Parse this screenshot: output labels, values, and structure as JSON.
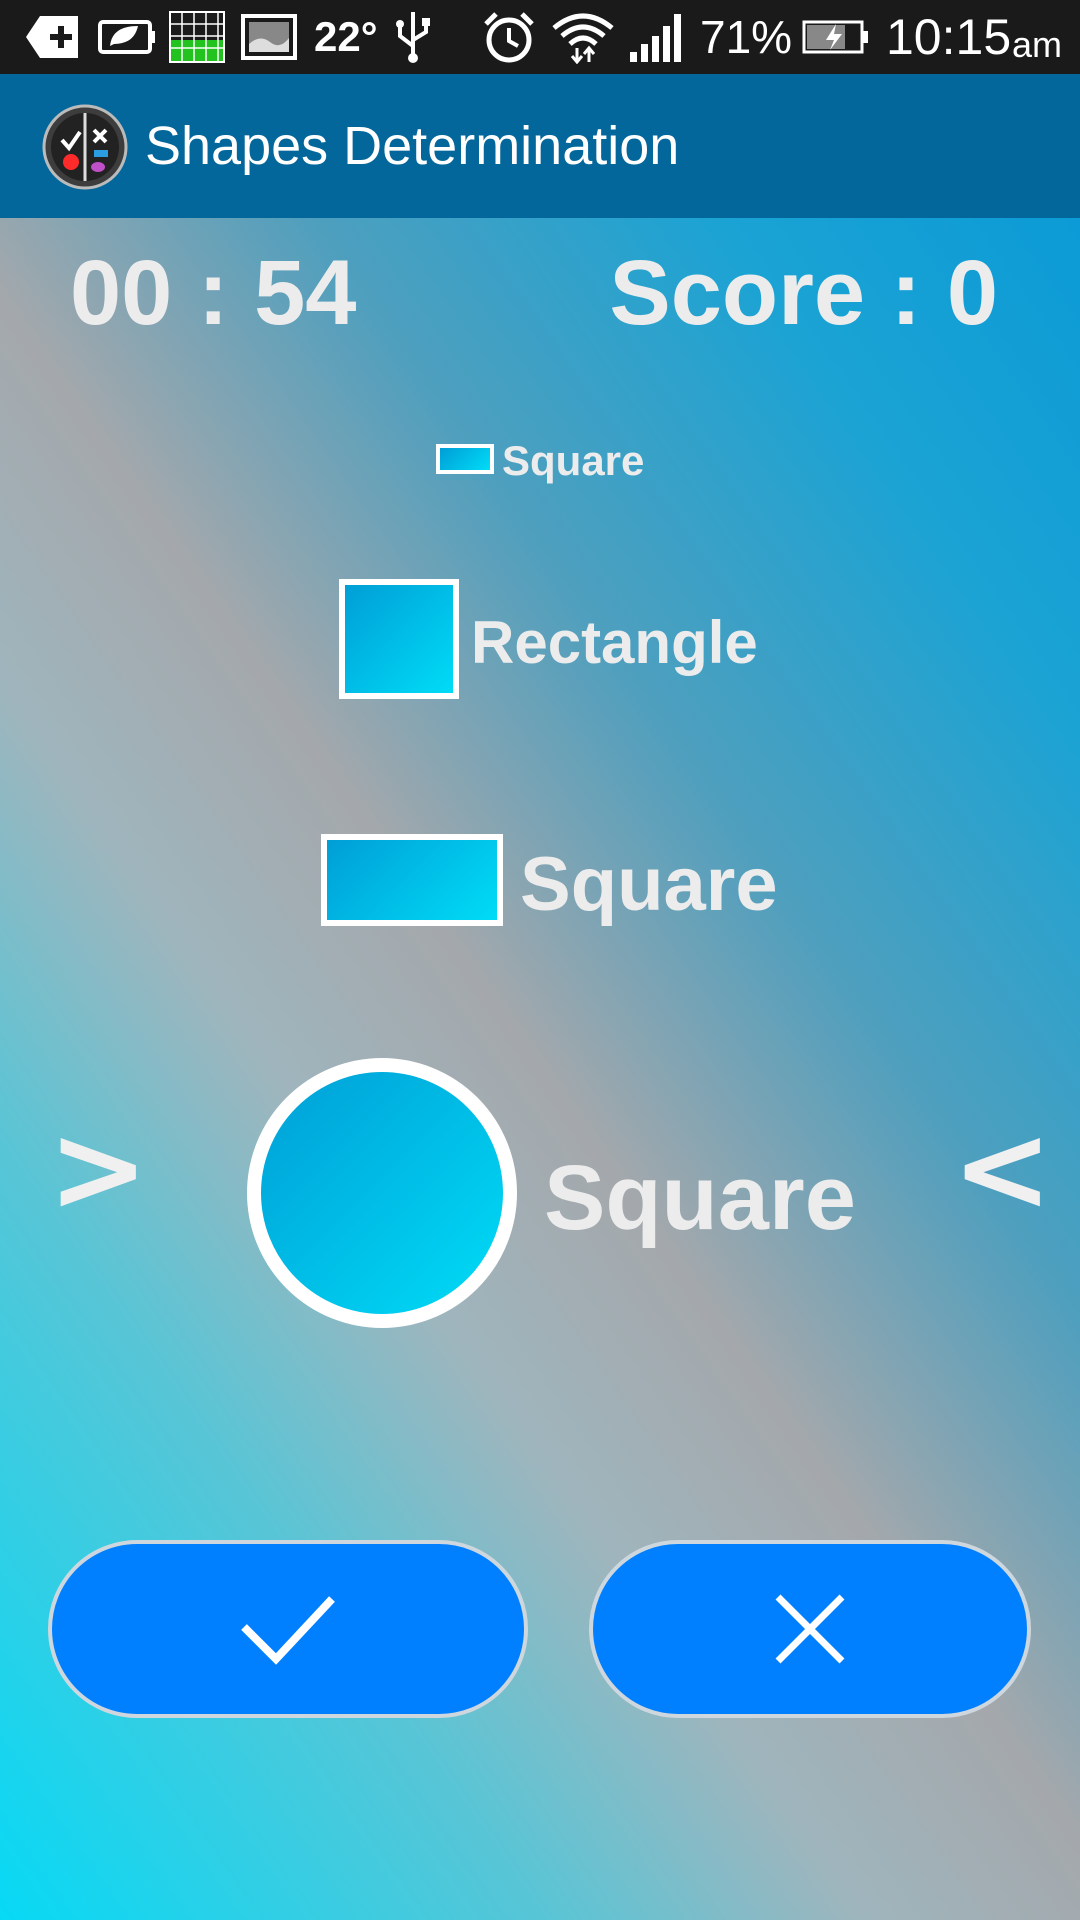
{
  "status_bar": {
    "temperature": "22°",
    "battery_percent": "71%",
    "time": "10:15",
    "ampm": "am",
    "icons": [
      "add-icon",
      "battery-saver-icon",
      "signal-grid-icon",
      "image-icon",
      "temperature-icon",
      "usb-icon",
      "alarm-icon",
      "wifi-icon",
      "cell-signal-icon",
      "battery-charging-icon"
    ]
  },
  "app_bar": {
    "title": "Shapes Determination",
    "logo_icon": "app-logo-icon"
  },
  "game": {
    "timer": "00 : 54",
    "score": "Score : 0",
    "previous_arrow": ">",
    "next_arrow": "<",
    "items": [
      {
        "shape": "rectangle",
        "label": "Square"
      },
      {
        "shape": "square",
        "label": "Rectangle"
      },
      {
        "shape": "rectangle",
        "label": "Square"
      },
      {
        "shape": "circle",
        "label": "Square"
      }
    ],
    "correct_icon": "check-icon",
    "wrong_icon": "close-icon"
  },
  "colors": {
    "app_bar": "#03679b",
    "status_bar": "#1a1a1a",
    "button": "#0080ff",
    "shape_fill_start": "#009ed6",
    "shape_fill_end": "#00dcf7"
  }
}
